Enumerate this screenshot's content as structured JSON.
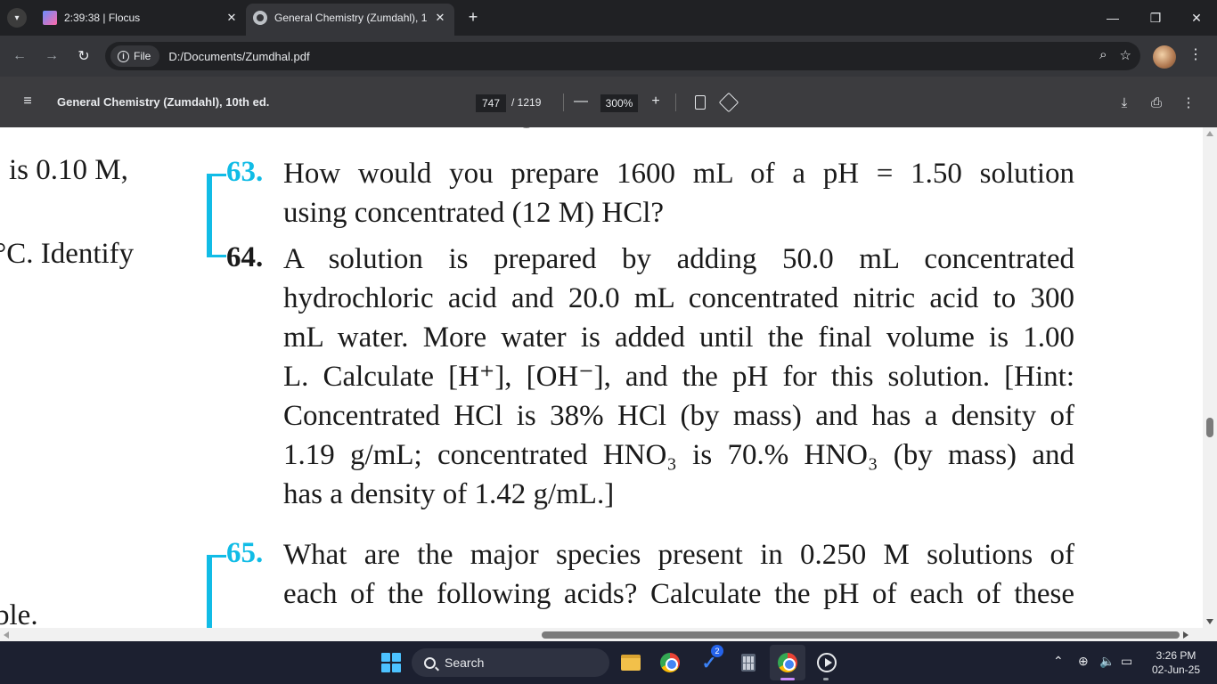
{
  "tabs": [
    {
      "title": "2:39:38 | Flocus",
      "close": "✕"
    },
    {
      "title": "General Chemistry (Zumdahl), 1",
      "close": "✕"
    }
  ],
  "new_tab": "+",
  "window_controls": {
    "minimize": "—",
    "restore": "❐",
    "close": "✕"
  },
  "address_bar": {
    "scheme_label": "File",
    "url": "D:/Documents/Zumdhal.pdf"
  },
  "pdf_toolbar": {
    "title": "General Chemistry (Zumdahl), 10th ed.",
    "current_page": "747",
    "total_pages": "/ 1219",
    "zoom": "300%",
    "zoom_minus": "—",
    "zoom_plus": "+"
  },
  "document": {
    "margin_fragments": [
      "is 0.10 M,",
      "°C. Identify",
      "ble."
    ],
    "questions": [
      {
        "number": "63.",
        "lines": [
          "How would you prepare 1600 mL of a pH = 1.50 solution",
          "using concentrated (12 M) HCl?"
        ]
      },
      {
        "number": "64.",
        "lines": [
          "A solution is prepared by adding 50.0 mL concentrated",
          "hydrochloric acid and 20.0 mL concentrated nitric acid to 300",
          "mL water. More water is added until the final volume is 1.00",
          "L. Calculate [H⁺], [OH⁻], and the pH for this solution. [Hint:",
          "Concentrated HCl is 38% HCl (by mass) and has a density of",
          "1.19 g/mL; concentrated HNO₃ is 70.% HNO₃ (by mass) and",
          "has a density of 1.42 g/mL.]"
        ]
      },
      {
        "number": "65.",
        "lines": [
          "What are the major species present in 0.250 M solutions of",
          "each of the following acids? Calculate the pH of each of these"
        ]
      }
    ]
  },
  "taskbar": {
    "search_label": "Search",
    "todo_badge": "2",
    "time": "3:26 PM",
    "date": "02-Jun-25"
  },
  "colors": {
    "accent_cyan": "#11bce6",
    "browser_bg": "#202124",
    "taskbar_bg": "#1c2030"
  }
}
